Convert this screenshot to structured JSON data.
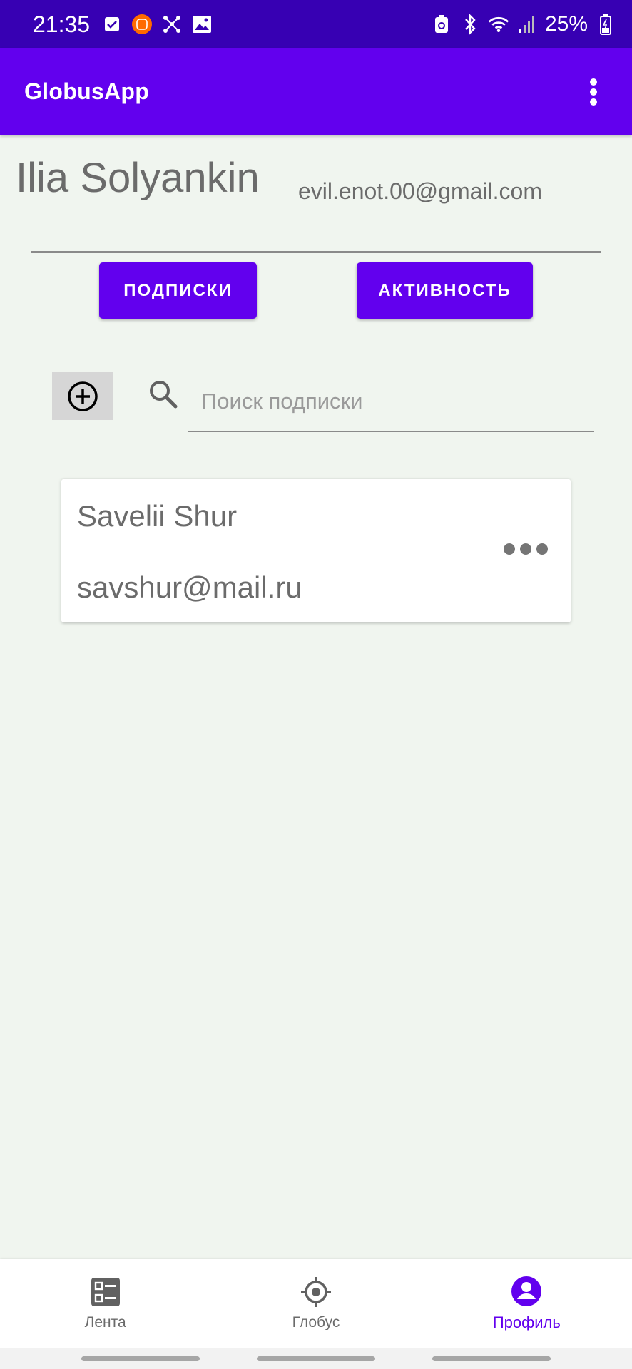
{
  "status_bar": {
    "time": "21:35",
    "battery": "25%"
  },
  "app_bar": {
    "title": "GlobusApp"
  },
  "profile": {
    "name": "Ilia Solyankin",
    "email": "evil.enot.00@gmail.com"
  },
  "buttons": {
    "subscriptions": "ПОДПИСКИ",
    "activity": "АКТИВНОСТЬ"
  },
  "search": {
    "placeholder": "Поиск подписки",
    "value": ""
  },
  "subscriptions": [
    {
      "name": "Savelii Shur",
      "email": "savshur@mail.ru"
    }
  ],
  "bottom_nav": {
    "items": [
      {
        "label": "Лента",
        "icon": "feed-list-icon"
      },
      {
        "label": "Глобус",
        "icon": "globe-target-icon"
      },
      {
        "label": "Профиль",
        "icon": "profile-icon"
      }
    ],
    "active_index": 2
  },
  "colors": {
    "status_bar": "#3700b3",
    "primary": "#6200ee",
    "background": "#f0f5ef"
  }
}
